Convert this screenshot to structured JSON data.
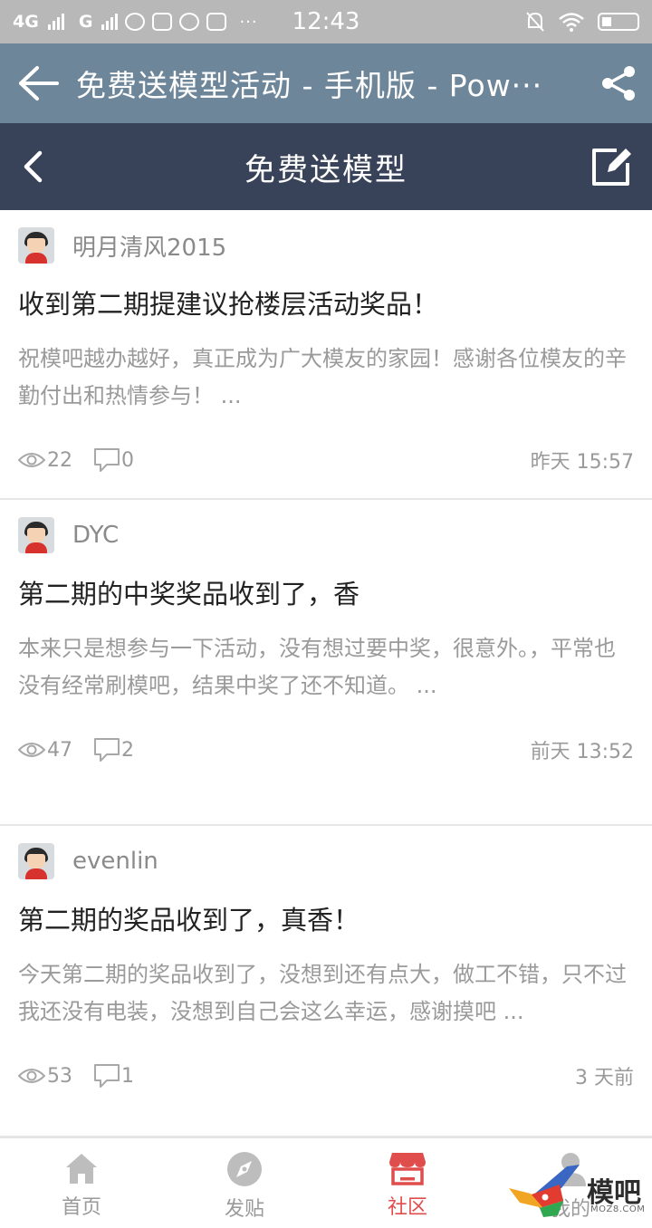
{
  "status_bar": {
    "network_1": "4G",
    "network_2": "G",
    "more": "···",
    "time": "12:43"
  },
  "browser": {
    "title": "免费送模型活动 - 手机版 - Pow···"
  },
  "page_header": {
    "title": "免费送模型"
  },
  "posts": [
    {
      "author": "明月清风2015",
      "title": "收到第二期提建议抢楼层活动奖品！",
      "excerpt": "祝模吧越办越好，真正成为广大模友的家园！感谢各位模友的辛勤付出和热情参与！ ...",
      "views": "22",
      "comments": "0",
      "time": "昨天 15:57"
    },
    {
      "author": "DYC",
      "title": "第二期的中奖奖品收到了，香",
      "excerpt": "本来只是想参与一下活动，没有想过要中奖，很意外。，平常也没有经常刷模吧，结果中奖了还不知道。 ...",
      "views": "47",
      "comments": "2",
      "time": "前天 13:52"
    },
    {
      "author": "evenlin",
      "title": "第二期的奖品收到了，真香！",
      "excerpt": "今天第二期的奖品收到了，没想到还有点大，做工不错，只不过我还没有电装，没想到自己会这么幸运，感谢摸吧 ...",
      "views": "53",
      "comments": "1",
      "time": "3 天前"
    }
  ],
  "tabbar": {
    "tabs": [
      {
        "label": "首页",
        "icon": "home-icon"
      },
      {
        "label": "发贴",
        "icon": "compass-icon"
      },
      {
        "label": "社区",
        "icon": "shop-icon"
      },
      {
        "label": "我的",
        "icon": "user-icon"
      }
    ],
    "active_index": 2
  },
  "watermark": {
    "text": "模吧",
    "url": "MOZ8.COM"
  },
  "colors": {
    "browser_bar": "#6e8699",
    "page_header": "#384259",
    "active_tab": "#e04d4d",
    "muted_text": "#9a9a9a"
  }
}
